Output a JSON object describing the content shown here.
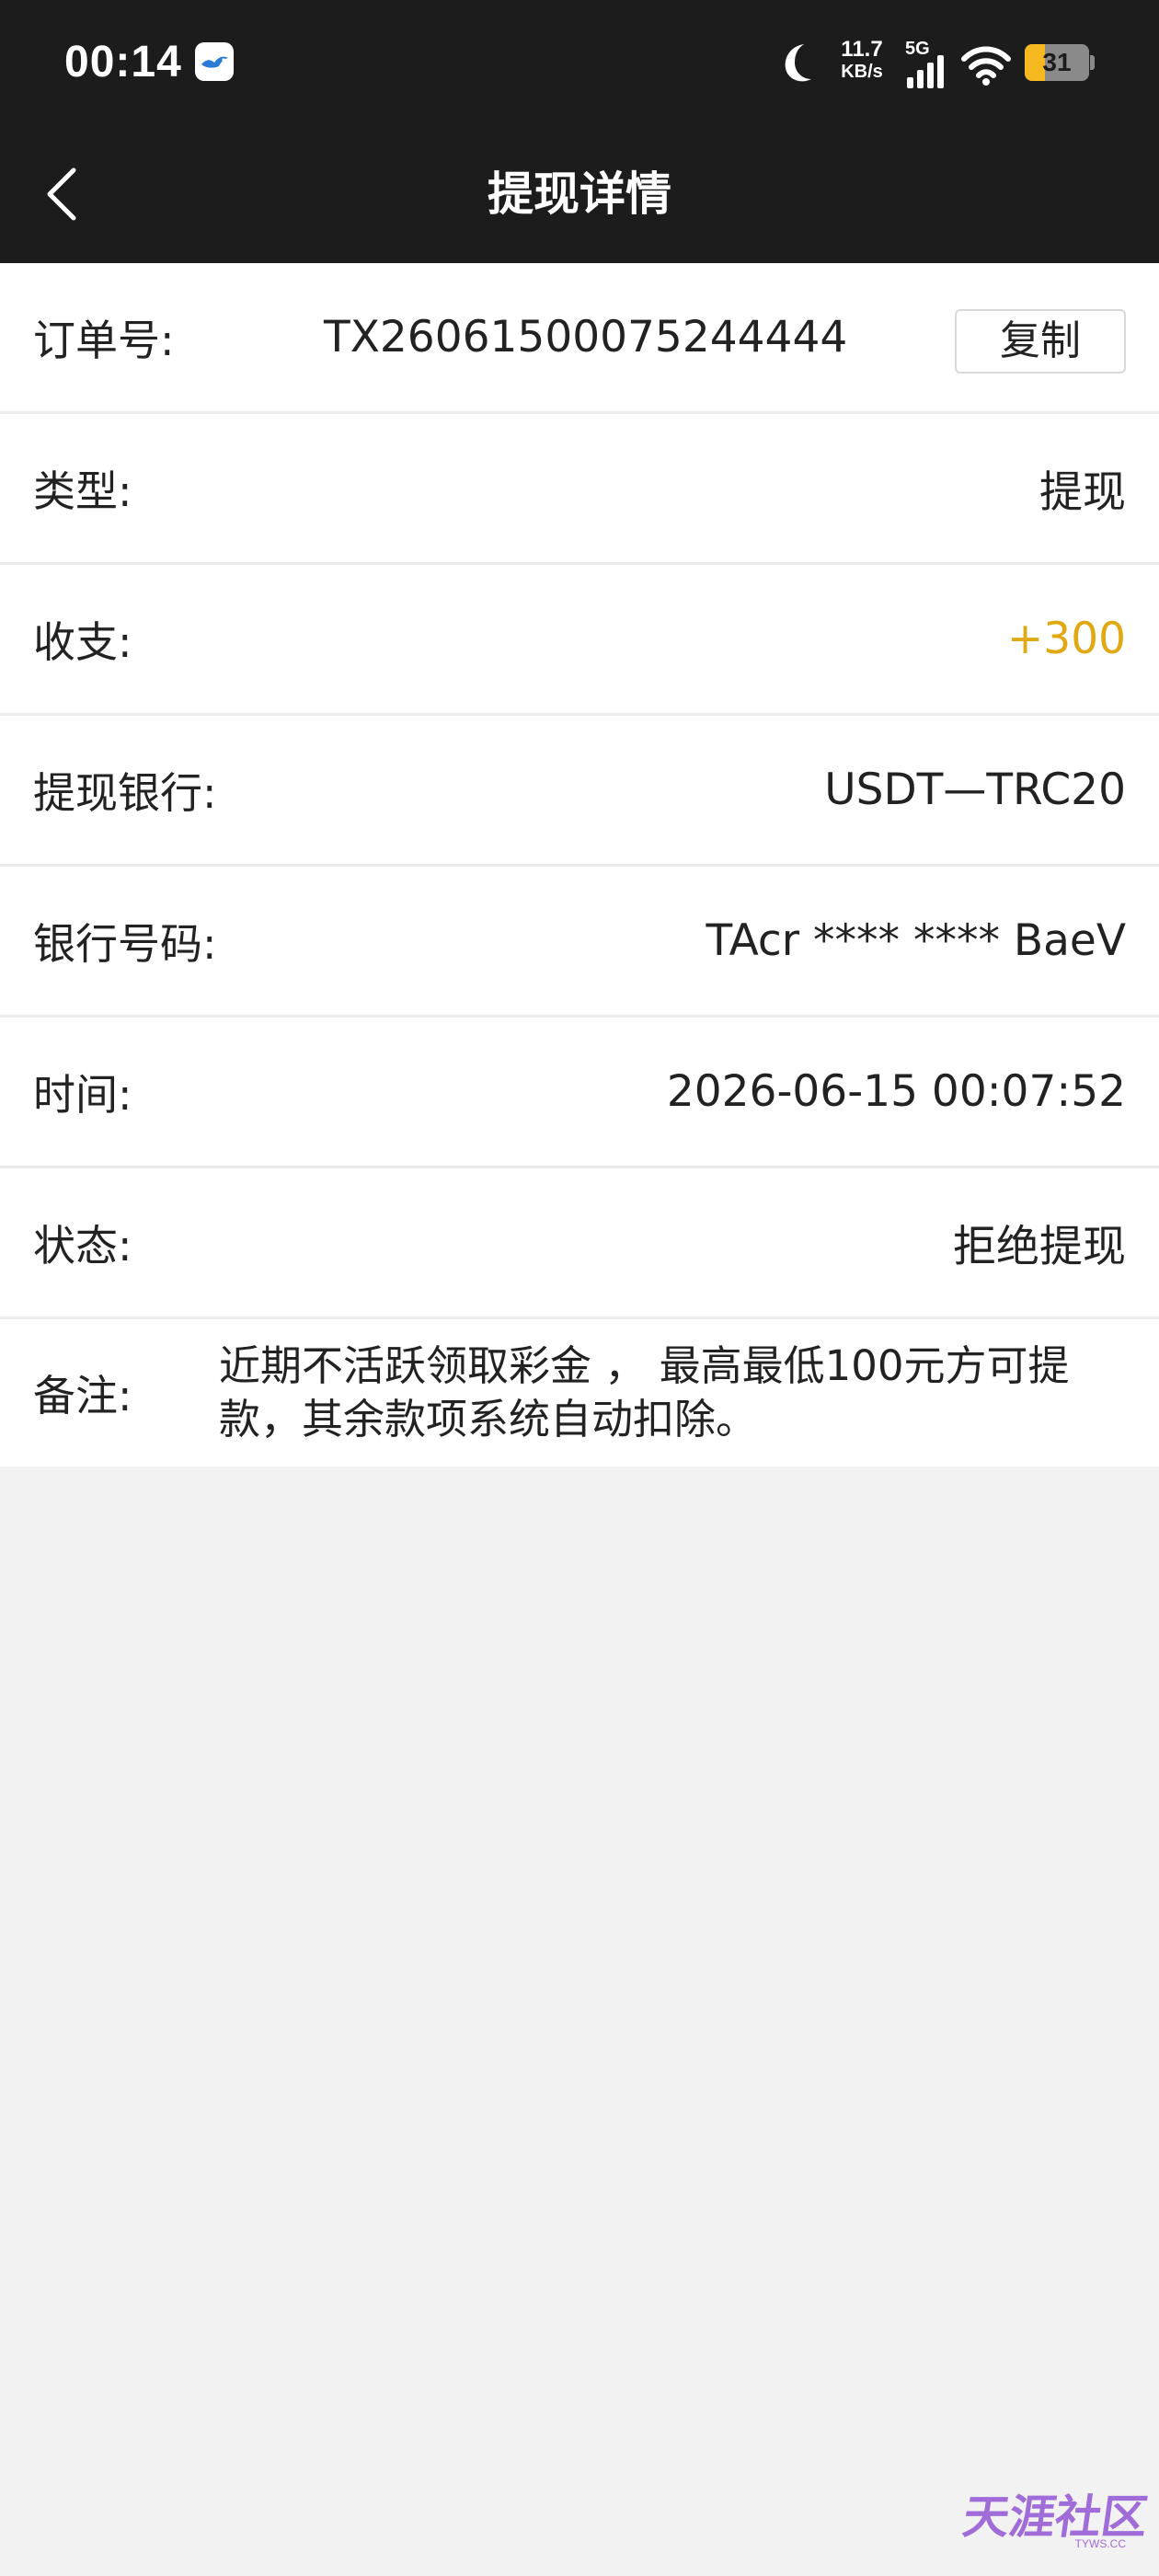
{
  "status_bar": {
    "time": "00:14",
    "net_speed_value": "11.7",
    "net_speed_unit": "KB/s",
    "network_type": "5G",
    "battery_level": "31",
    "battery_fraction": 0.31
  },
  "header": {
    "title": "提现详情"
  },
  "details": {
    "order": {
      "label": "订单号:",
      "value": "TX26061500075244444",
      "copy_label": "复制"
    },
    "type": {
      "label": "类型:",
      "value": "提现"
    },
    "amount": {
      "label": "收支:",
      "value": "+300"
    },
    "bank": {
      "label": "提现银行:",
      "value": "USDT—TRC20"
    },
    "account": {
      "label": "银行号码:",
      "value": "TAcr **** **** BaeV"
    },
    "time": {
      "label": "时间:",
      "value": "2026-06-15 00:07:52"
    },
    "status": {
      "label": "状态:",
      "value": "拒绝提现"
    },
    "note": {
      "label": "备注:",
      "value": "近期不活跃领取彩金 ， 最高最低100元方可提款，其余款项系统自动扣除。"
    }
  },
  "watermark": {
    "text": "天涯社区",
    "sub": "TYWS.CC"
  },
  "colors": {
    "header_bg": "#1c1c1c",
    "page_bg": "#f2f2f2",
    "amount": "#e0a812",
    "battery": "#f5b81f"
  },
  "icons": {
    "back": "chevron-left-icon",
    "app": "bird-app-icon",
    "moon": "moon-icon",
    "signal": "signal-icon",
    "wifi": "wifi-icon",
    "battery": "battery-icon"
  }
}
